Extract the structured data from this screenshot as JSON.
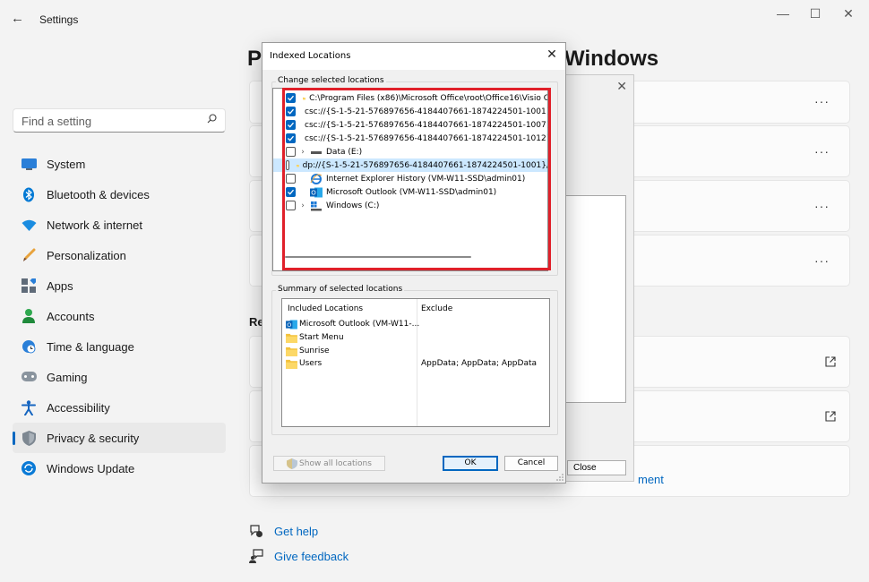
{
  "settings": {
    "app_title": "Settings",
    "search_placeholder": "Find a setting",
    "nav": [
      {
        "label": "System",
        "icon": "system-icon"
      },
      {
        "label": "Bluetooth & devices",
        "icon": "bluetooth-icon"
      },
      {
        "label": "Network & internet",
        "icon": "wifi-icon"
      },
      {
        "label": "Personalization",
        "icon": "brush-icon"
      },
      {
        "label": "Apps",
        "icon": "apps-icon"
      },
      {
        "label": "Accounts",
        "icon": "person-icon"
      },
      {
        "label": "Time & language",
        "icon": "globe-clock-icon"
      },
      {
        "label": "Gaming",
        "icon": "gamepad-icon"
      },
      {
        "label": "Accessibility",
        "icon": "accessibility-icon"
      },
      {
        "label": "Privacy & security",
        "icon": "shield-icon",
        "active": true
      },
      {
        "label": "Windows Update",
        "icon": "update-icon"
      }
    ],
    "page_title_left": "Pr",
    "page_title_right": "Windows",
    "section_re": "Re",
    "mgmt_fragment": "ment",
    "links": [
      {
        "label": "Get help",
        "icon": "help-icon"
      },
      {
        "label": "Give feedback",
        "icon": "feedback-icon"
      }
    ],
    "accent": "#0067c0"
  },
  "background_dialog": {
    "close_label": "Close"
  },
  "dialog": {
    "title": "Indexed Locations",
    "change_group_label": "Change selected locations",
    "tree": [
      {
        "checked": true,
        "expander": false,
        "icon": "folder-icon",
        "text": "C:\\Program Files (x86)\\Microsoft Office\\root\\Office16\\Visio C"
      },
      {
        "checked": true,
        "expander": false,
        "icon": "folder-icon",
        "text": "csc://{S-1-5-21-576897656-4184407661-1874224501-1001}"
      },
      {
        "checked": true,
        "expander": false,
        "icon": "folder-icon",
        "text": "csc://{S-1-5-21-576897656-4184407661-1874224501-1007}"
      },
      {
        "checked": true,
        "expander": false,
        "icon": "folder-icon",
        "text": "csc://{S-1-5-21-576897656-4184407661-1874224501-1012}"
      },
      {
        "checked": false,
        "expander": true,
        "icon": "drive-icon",
        "text": "Data (E:)"
      },
      {
        "checked": false,
        "expander": false,
        "icon": "folder-icon",
        "text": "dp://{S-1-5-21-576897656-4184407661-1874224501-1001}/",
        "selected": true
      },
      {
        "checked": false,
        "expander": false,
        "icon": "ie-icon",
        "text": "Internet Explorer History (VM-W11-SSD\\admin01)"
      },
      {
        "checked": true,
        "expander": false,
        "icon": "outlook-icon",
        "text": "Microsoft Outlook (VM-W11-SSD\\admin01)"
      },
      {
        "checked": false,
        "expander": true,
        "icon": "windows-drive-icon",
        "text": "Windows (C:)"
      }
    ],
    "summary_group_label": "Summary of selected locations",
    "summary_headers": {
      "included": "Included Locations",
      "exclude": "Exclude"
    },
    "summary_rows": [
      {
        "icon": "outlook-icon",
        "included": "Microsoft Outlook (VM-W11-...",
        "exclude": ""
      },
      {
        "icon": "folder-icon",
        "included": "Start Menu",
        "exclude": ""
      },
      {
        "icon": "folder-icon",
        "included": "Sunrise",
        "exclude": ""
      },
      {
        "icon": "folder-icon",
        "included": "Users",
        "exclude": "AppData; AppData; AppData"
      }
    ],
    "show_all_label": "Show all locations",
    "ok_label": "OK",
    "cancel_label": "Cancel",
    "highlight_color": "#e0202a"
  }
}
